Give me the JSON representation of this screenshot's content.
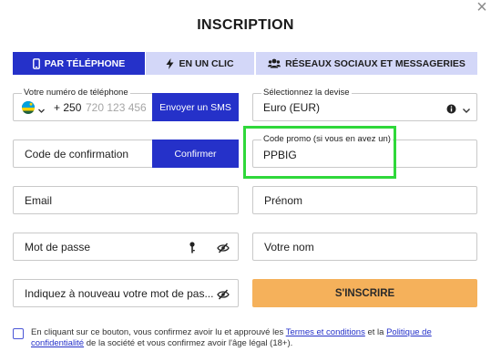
{
  "dialog": {
    "title": "INSCRIPTION",
    "close_icon": "close-icon",
    "close_glyph": "×"
  },
  "tabs": [
    {
      "label": "PAR TÉLÉPHONE",
      "icon": "phone-icon",
      "active": true
    },
    {
      "label": "EN UN CLIC",
      "icon": "lightning-icon",
      "active": false
    },
    {
      "label": "RÉSEAUX SOCIAUX ET MESSAGERIES",
      "icon": "users-icon",
      "active": false
    }
  ],
  "phone": {
    "label": "Votre numéro de téléphone",
    "country_code": "+ 250",
    "placeholder": "720 123 456",
    "send_sms_label": "Envoyer un SMS"
  },
  "currency": {
    "label": "Sélectionnez la devise",
    "value": "Euro (EUR)",
    "info_icon": "info-icon",
    "chevron_icon": "chevron-down-icon"
  },
  "confirmation": {
    "placeholder": "Code de confirmation",
    "button_label": "Confirmer"
  },
  "promo": {
    "label": "Code promo (si vous en avez un)",
    "value": "PPBIG"
  },
  "email": {
    "placeholder": "Email"
  },
  "first_name": {
    "placeholder": "Prénom"
  },
  "password": {
    "placeholder": "Mot de passe"
  },
  "last_name": {
    "placeholder": "Votre nom"
  },
  "password_confirm": {
    "placeholder": "Indiquez à nouveau votre mot de pas..."
  },
  "submit_label": "S'INSCRIRE",
  "terms": {
    "part1": "En cliquant sur ce bouton, vous confirmez avoir lu et approuvé les ",
    "link1": "Termes et conditions",
    "part2": " et la ",
    "link2": "Politique de confidentialité",
    "part3": " de la société et vous confirmez avoir l'âge légal (18+)."
  },
  "colors": {
    "accent": "#2531c9",
    "tab_inactive": "#d3d7f8",
    "submit": "#f5b15b",
    "highlight": "#2fd83a"
  }
}
